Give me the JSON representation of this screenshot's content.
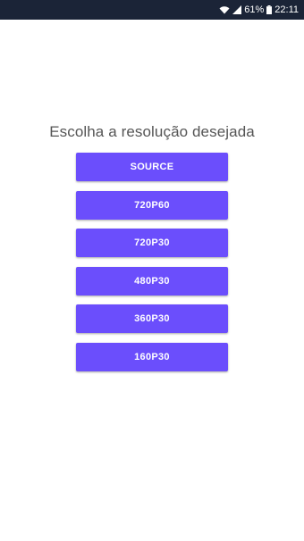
{
  "status_bar": {
    "battery": "61%",
    "time": "22:11",
    "icons": [
      "wifi-icon",
      "signal-icon",
      "battery-icon"
    ]
  },
  "main": {
    "title": "Escolha a resolução desejada",
    "buttons": [
      {
        "label": "SOURCE"
      },
      {
        "label": "720P60"
      },
      {
        "label": "720P30"
      },
      {
        "label": "480P30"
      },
      {
        "label": "360P30"
      },
      {
        "label": "160P30"
      }
    ]
  },
  "colors": {
    "status_bar_bg": "#1b2437",
    "button_bg": "#6b4efc",
    "title_text": "#555555"
  }
}
